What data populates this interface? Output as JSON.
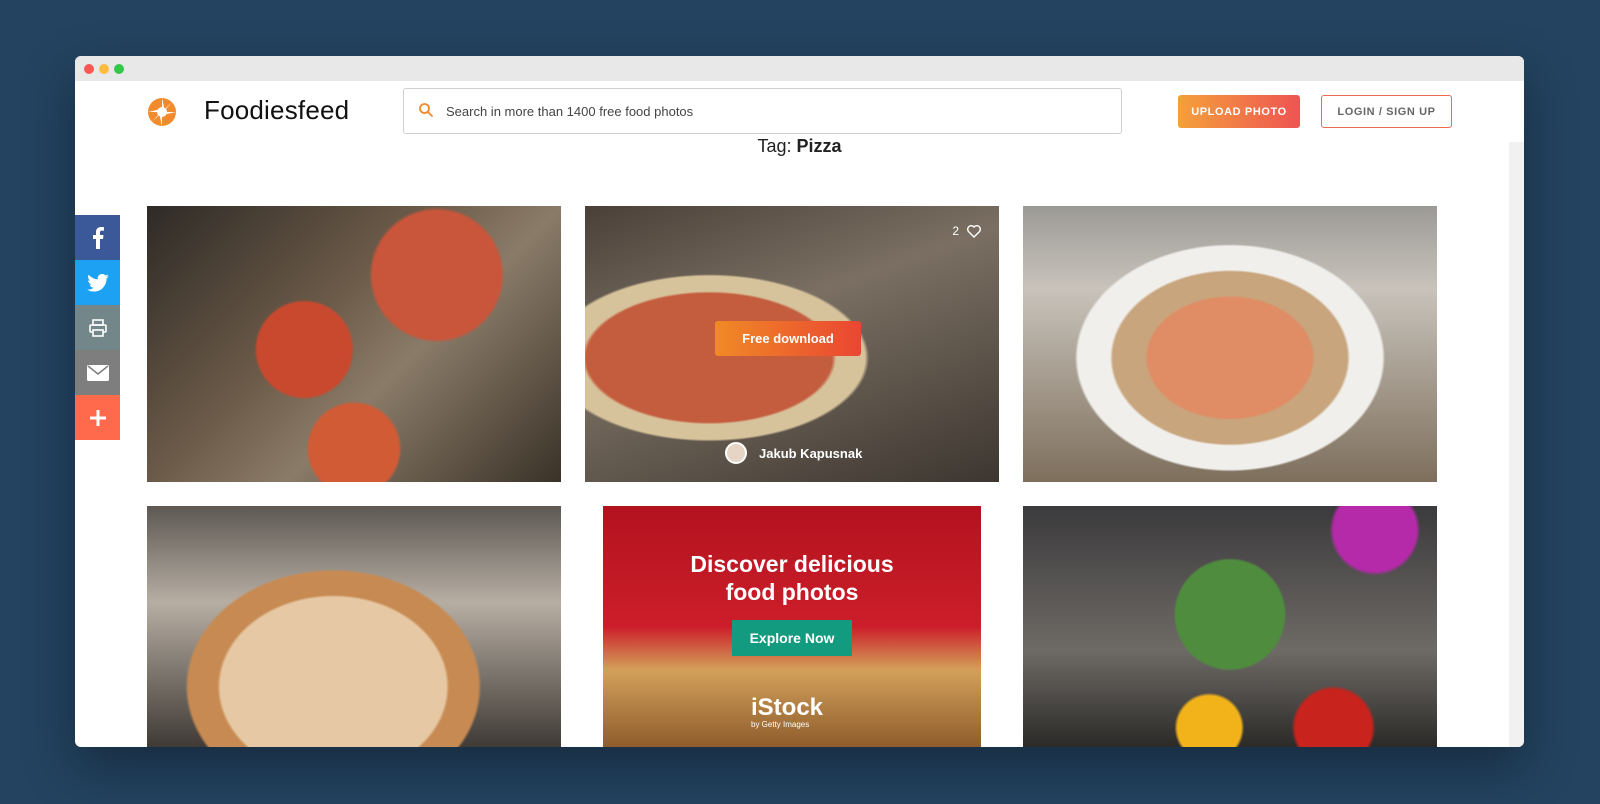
{
  "window": {
    "brand": "Foodiesfeed"
  },
  "search": {
    "placeholder": "Search in more than 1400 free food photos"
  },
  "header": {
    "upload_label": "UPLOAD PHOTO",
    "login_label": "LOGIN / SIGN UP"
  },
  "tag": {
    "prefix": "Tag:",
    "name": "Pizza"
  },
  "share": [
    {
      "icon": "facebook-icon",
      "color": "#3b5998"
    },
    {
      "icon": "twitter-icon",
      "color": "#1da1f2"
    },
    {
      "icon": "print-icon",
      "color": "#73878b"
    },
    {
      "icon": "email-icon",
      "color": "#7e7e7e"
    },
    {
      "icon": "plus-icon",
      "color": "#ff6a4d"
    }
  ],
  "photos": {
    "featured": {
      "likes": "2",
      "download_label": "Free download",
      "author": "Jakub Kapusnak"
    }
  },
  "ad": {
    "title_line1": "Discover delicious",
    "title_line2": "food photos",
    "cta": "Explore Now",
    "brand": "iStock",
    "brand_sub": "by Getty Images"
  },
  "colors": {
    "background": "#234360",
    "accent_start": "#f4a03b",
    "accent_end": "#ee5453"
  }
}
